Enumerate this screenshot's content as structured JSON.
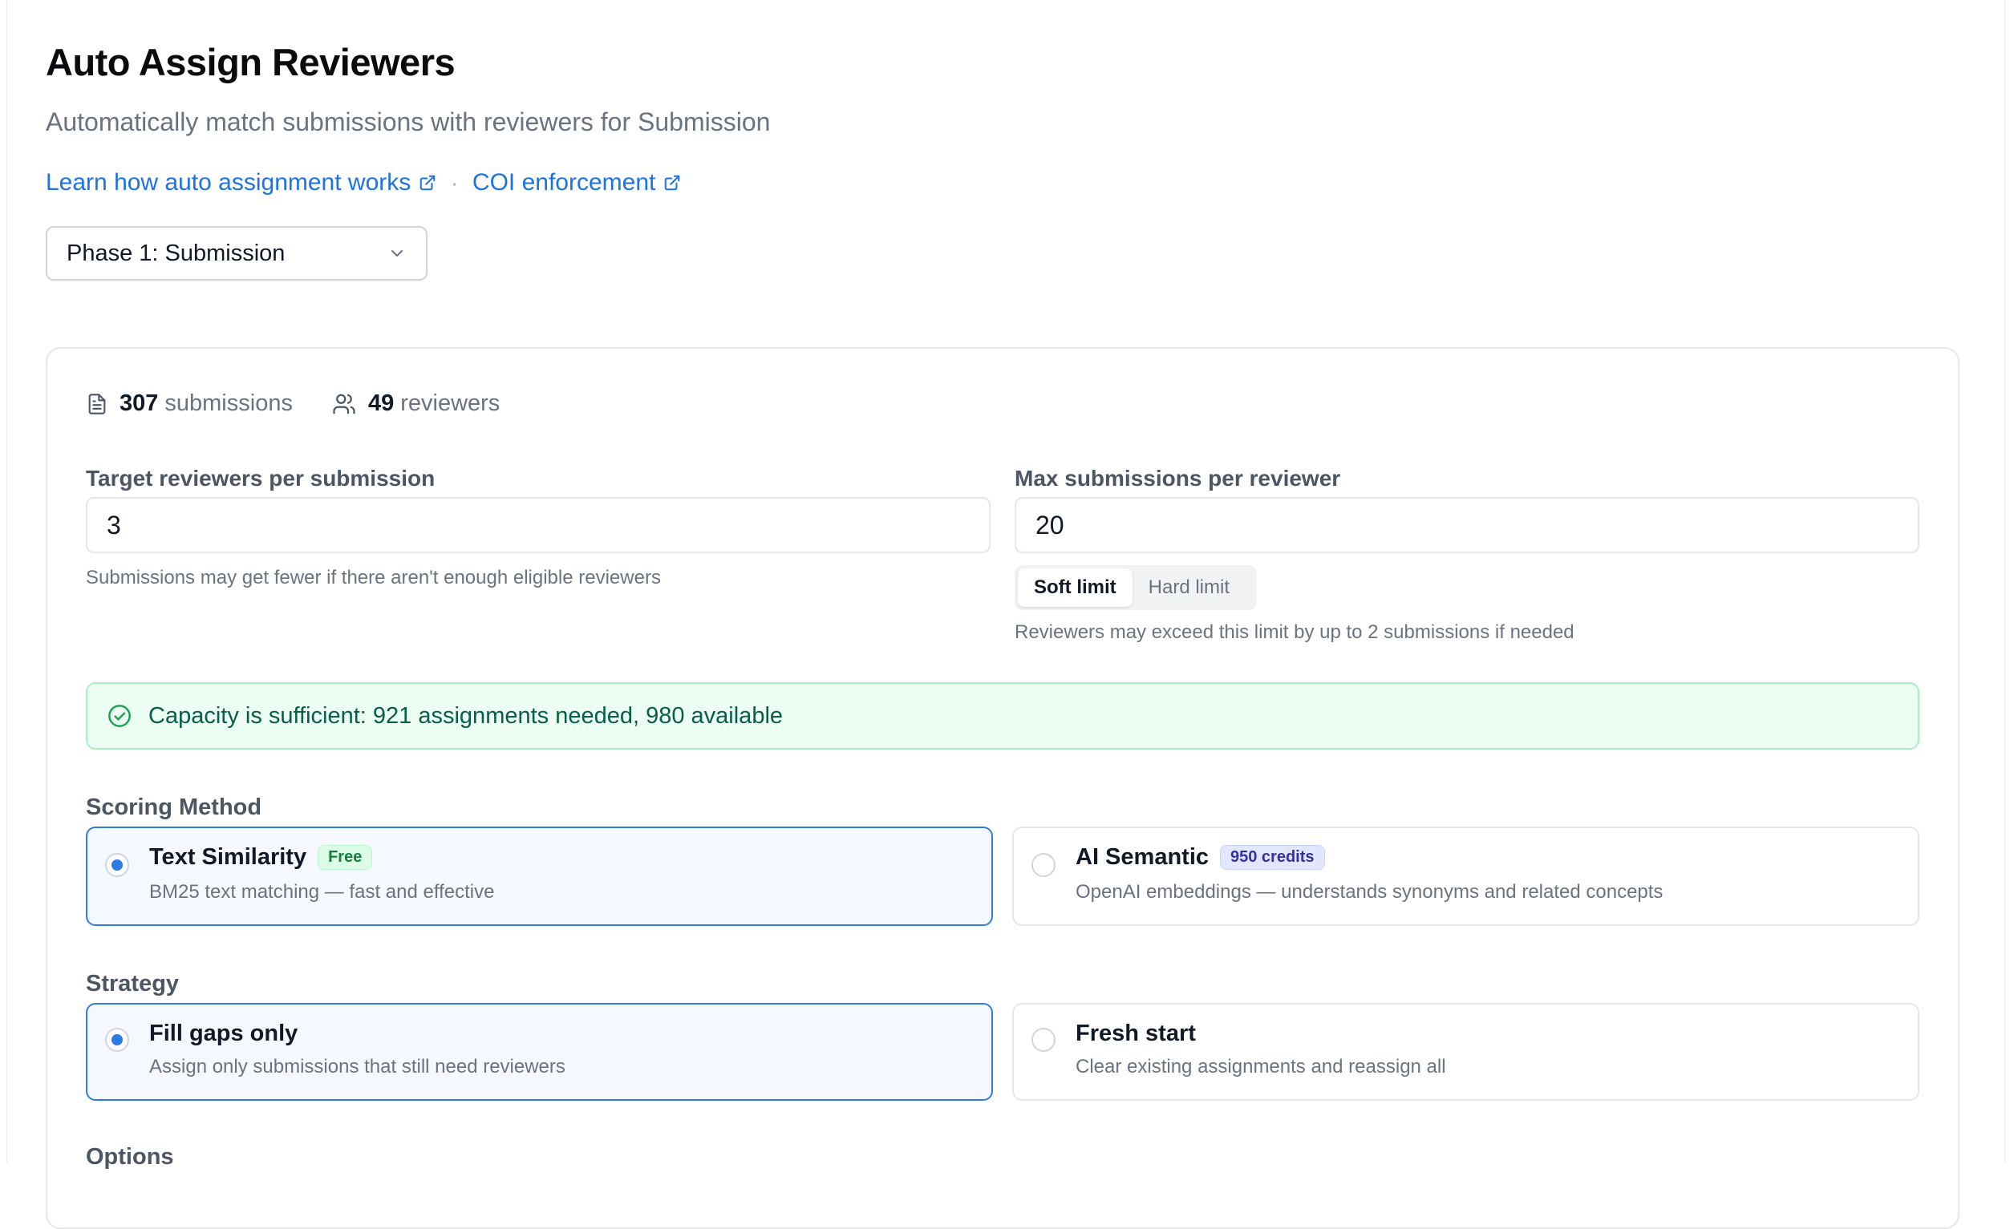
{
  "header": {
    "title": "Auto Assign Reviewers",
    "subtitle": "Automatically match submissions with reviewers for Submission",
    "links": [
      {
        "label": "Learn how auto assignment works",
        "icon": "external-link-icon"
      },
      {
        "label": "COI enforcement",
        "icon": "external-link-icon"
      }
    ],
    "separator": "·"
  },
  "phase_select": {
    "value": "Phase 1: Submission",
    "icon": "chevron-down-icon"
  },
  "stats": {
    "submissions_count": "307",
    "submissions_label": "submissions",
    "reviewers_count": "49",
    "reviewers_label": "reviewers"
  },
  "target": {
    "label": "Target reviewers per submission",
    "value": "3",
    "help": "Submissions may get fewer if there aren't enough eligible reviewers"
  },
  "max": {
    "label": "Max submissions per reviewer",
    "value": "20",
    "limit_options": [
      "Soft limit",
      "Hard limit"
    ],
    "selected_limit": "Soft limit",
    "help": "Reviewers may exceed this limit by up to 2 submissions if needed"
  },
  "capacity_alert": {
    "text": "Capacity is sufficient: 921 assignments needed, 980 available",
    "color": "#065f46"
  },
  "scoring": {
    "label": "Scoring Method",
    "options": [
      {
        "title": "Text Similarity",
        "badge": "Free",
        "desc": "BM25 text matching — fast and effective",
        "selected": true
      },
      {
        "title": "AI Semantic",
        "badge": "950 credits",
        "desc": "OpenAI embeddings — understands synonyms and related concepts",
        "selected": false
      }
    ]
  },
  "strategy": {
    "label": "Strategy",
    "options": [
      {
        "title": "Fill gaps only",
        "desc": "Assign only submissions that still need reviewers",
        "selected": true
      },
      {
        "title": "Fresh start",
        "desc": "Clear existing assignments and reassign all",
        "selected": false
      }
    ]
  },
  "options_section": {
    "label": "Options"
  },
  "colors": {
    "accent": "#2f7be5",
    "link": "#1d72e8",
    "success_bg": "#ecfdf3"
  }
}
